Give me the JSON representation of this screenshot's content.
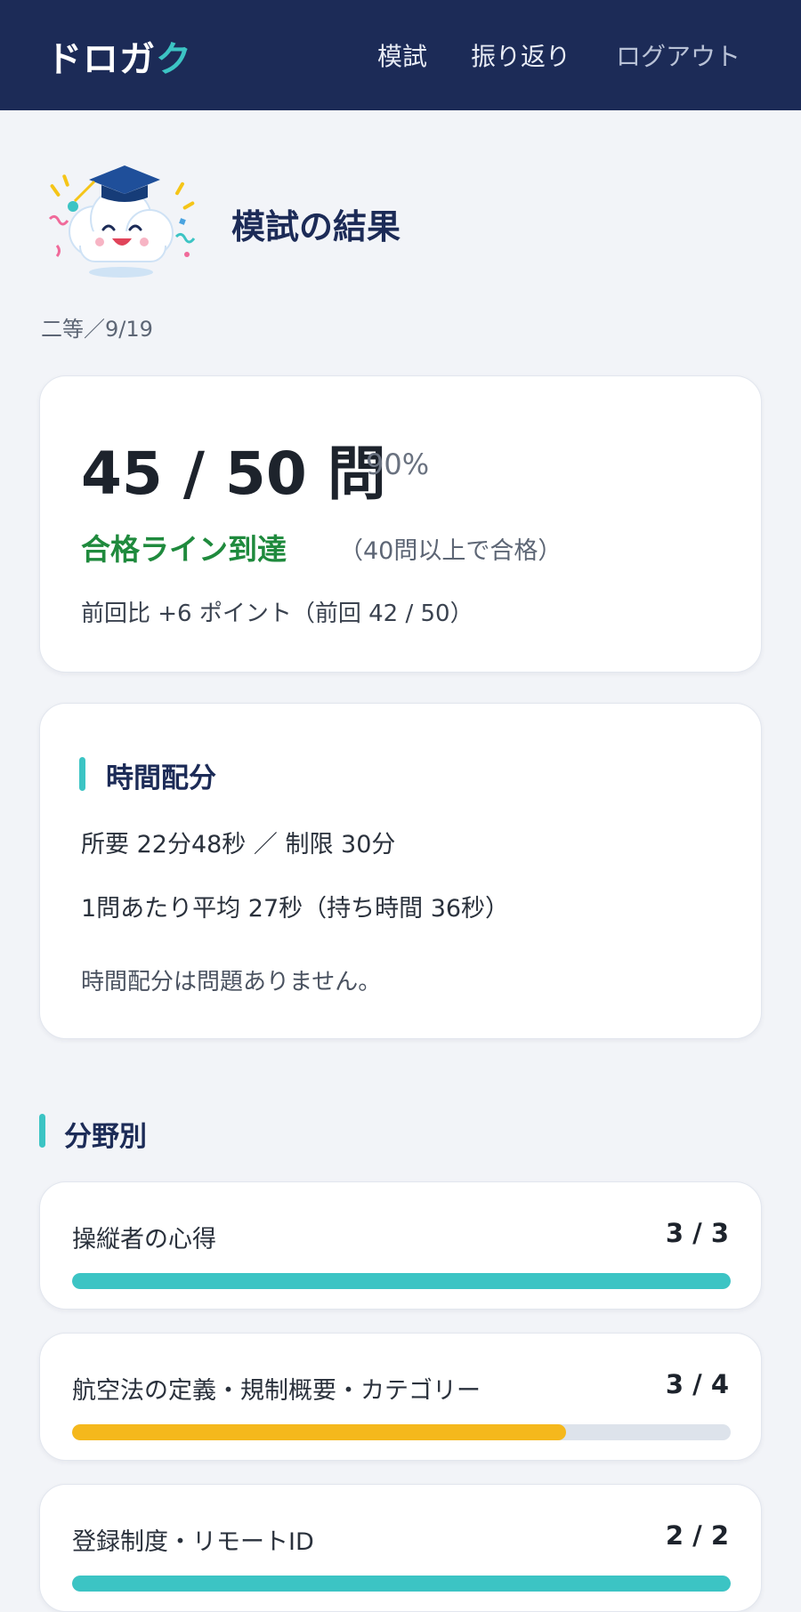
{
  "header": {
    "logo_main": "ドロガ",
    "logo_accent": "ク",
    "nav": [
      {
        "label": "模試"
      },
      {
        "label": "振り返り"
      },
      {
        "label": "ログアウト"
      }
    ]
  },
  "page": {
    "title": "模試の結果",
    "exam_meta": "二等／9/19"
  },
  "score": {
    "main": "45 / 50 問",
    "percent": "90%",
    "pass_status": "合格ライン到達",
    "pass_note": "（40問以上で合格）",
    "previous_compare": "前回比 +6 ポイント（前回 42 / 50）"
  },
  "time": {
    "heading": "時間配分",
    "required": "所要 22分48秒 ／ 制限 30分",
    "average": "1問あたり平均 27秒（持ち時間 36秒）",
    "comment": "時間配分は問題ありません。"
  },
  "fields": {
    "heading": "分野別",
    "items": [
      {
        "name": "操縦者の心得",
        "score": "3 / 3",
        "ratio": 1.0,
        "color": "#3cc4c4"
      },
      {
        "name": "航空法の定義・規制概要・カテゴリー",
        "score": "3 / 4",
        "ratio": 0.75,
        "color": "#f5b81c"
      },
      {
        "name": "登録制度・リモートID",
        "score": "2 / 2",
        "ratio": 1.0,
        "color": "#3cc4c4"
      }
    ]
  },
  "colors": {
    "header_bg": "#1c2b57",
    "accent_teal": "#3cc4c4",
    "pass_green": "#1f8a3d",
    "bar_warning": "#f5b81c"
  }
}
